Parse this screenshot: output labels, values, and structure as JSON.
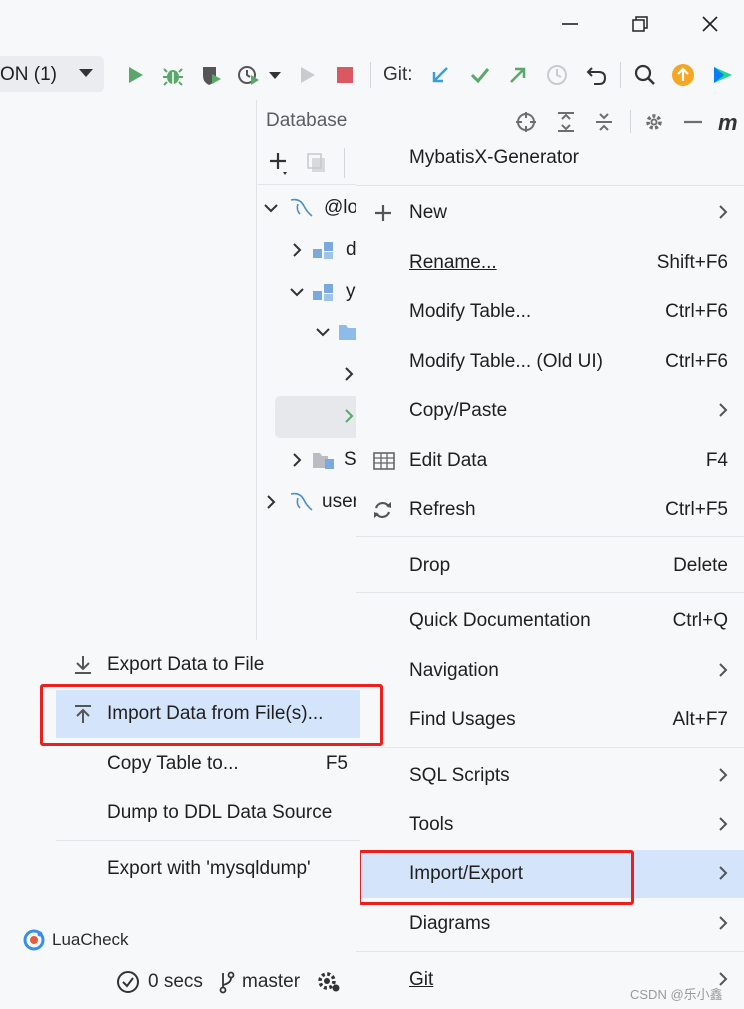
{
  "window": {
    "minimize_icon": "minimize-icon",
    "restore_icon": "restore-icon",
    "close_icon": "close-icon"
  },
  "toolbar": {
    "run_config_label": "ON (1)",
    "git_label": "Git:",
    "icons": [
      "run-icon",
      "debug-icon",
      "coverage-icon",
      "profile-icon",
      "stop-icon",
      "git-update-icon",
      "git-commit-icon",
      "git-push-icon",
      "history-icon",
      "rollback-icon",
      "search-icon",
      "update-icon",
      "jetbrains-icon"
    ]
  },
  "database_panel": {
    "title": "Database",
    "tree": [
      {
        "label": "@lo",
        "depth": 0,
        "expanded": true
      },
      {
        "label": "d",
        "depth": 1,
        "expanded": false
      },
      {
        "label": "y",
        "depth": 1,
        "expanded": true
      },
      {
        "label": "",
        "depth": 2,
        "expanded": true
      },
      {
        "label": "",
        "depth": 3,
        "expanded": false
      },
      {
        "label": "",
        "depth": 3,
        "expanded": false,
        "selected": true
      },
      {
        "label": "S",
        "depth": 1,
        "expanded": false
      },
      {
        "label": "user",
        "depth": 0,
        "expanded": false
      }
    ]
  },
  "context_menu": {
    "items": [
      {
        "label": "MybatisX-Generator",
        "shortcut": ""
      },
      {
        "label": "New",
        "shortcut": "",
        "submenu": true
      },
      {
        "label": "Rename...",
        "shortcut": "Shift+F6"
      },
      {
        "label": "Modify Table...",
        "shortcut": "Ctrl+F6"
      },
      {
        "label": "Modify Table... (Old UI)",
        "shortcut": "Ctrl+F6"
      },
      {
        "label": "Copy/Paste",
        "shortcut": "",
        "submenu": true
      },
      {
        "label": "Edit Data",
        "shortcut": "F4"
      },
      {
        "label": "Refresh",
        "shortcut": "Ctrl+F5"
      },
      {
        "label": "Drop",
        "shortcut": "Delete"
      },
      {
        "label": "Quick Documentation",
        "shortcut": "Ctrl+Q"
      },
      {
        "label": "Navigation",
        "shortcut": "",
        "submenu": true
      },
      {
        "label": "Find Usages",
        "shortcut": "Alt+F7"
      },
      {
        "label": "SQL Scripts",
        "shortcut": "",
        "submenu": true
      },
      {
        "label": "Tools",
        "shortcut": "",
        "submenu": true
      },
      {
        "label": "Import/Export",
        "shortcut": "",
        "submenu": true,
        "selected": true
      },
      {
        "label": "Diagrams",
        "shortcut": "",
        "submenu": true
      },
      {
        "label": "Git",
        "shortcut": "",
        "submenu": true
      }
    ]
  },
  "submenu": {
    "items": [
      {
        "label": "Export Data to File",
        "shortcut": ""
      },
      {
        "label": "Import Data from File(s)...",
        "shortcut": "",
        "selected": true
      },
      {
        "label": "Copy Table to...",
        "shortcut": "F5"
      },
      {
        "label": "Dump to DDL Data Source",
        "shortcut": ""
      },
      {
        "label": "Export with 'mysqldump'",
        "shortcut": ""
      }
    ]
  },
  "status_bar": {
    "luacheck_label": "LuaCheck",
    "timer_label": "0 secs",
    "branch_label": "master"
  },
  "watermark": "CSDN @乐小鑫",
  "colors": {
    "highlight": "#d4e4fb",
    "annotation_red": "#ec1f1f",
    "run_green": "#59a869",
    "stop_red": "#db5860",
    "git_blue": "#389fd6"
  }
}
